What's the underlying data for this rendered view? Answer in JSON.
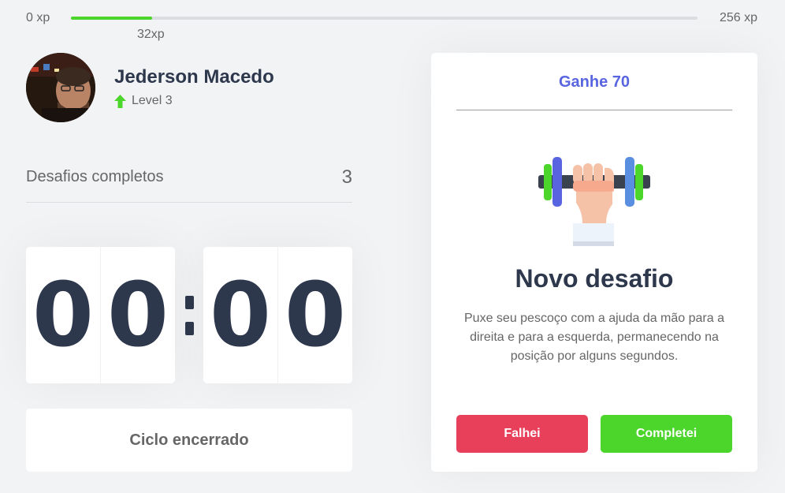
{
  "xp": {
    "min_label": "0 xp",
    "max_label": "256 xp",
    "current_label": "32xp",
    "progress": 0.13
  },
  "profile": {
    "name": "Jederson Macedo",
    "level_label": "Level 3",
    "level_icon": "level-up-arrow-icon"
  },
  "stats": {
    "completed_label": "Desafios completos",
    "completed_count": "3"
  },
  "countdown": {
    "minute_left": "0",
    "minute_right": "0",
    "second_left": "0",
    "second_right": "0"
  },
  "cycle_button_label": "Ciclo encerrado",
  "challenge": {
    "header": "Ganhe 70",
    "icon": "dumbbell-icon",
    "title": "Novo desafio",
    "description": "Puxe seu pescoço com a ajuda da mão para a direita e para a esquerda, permanecendo na posição por alguns segundos.",
    "failed_label": "Falhei",
    "completed_label": "Completei"
  },
  "colors": {
    "accent_blue": "#5965e0",
    "success_green": "#4cd62b",
    "danger_red": "#e83f5b",
    "title_text": "#2e384d"
  }
}
